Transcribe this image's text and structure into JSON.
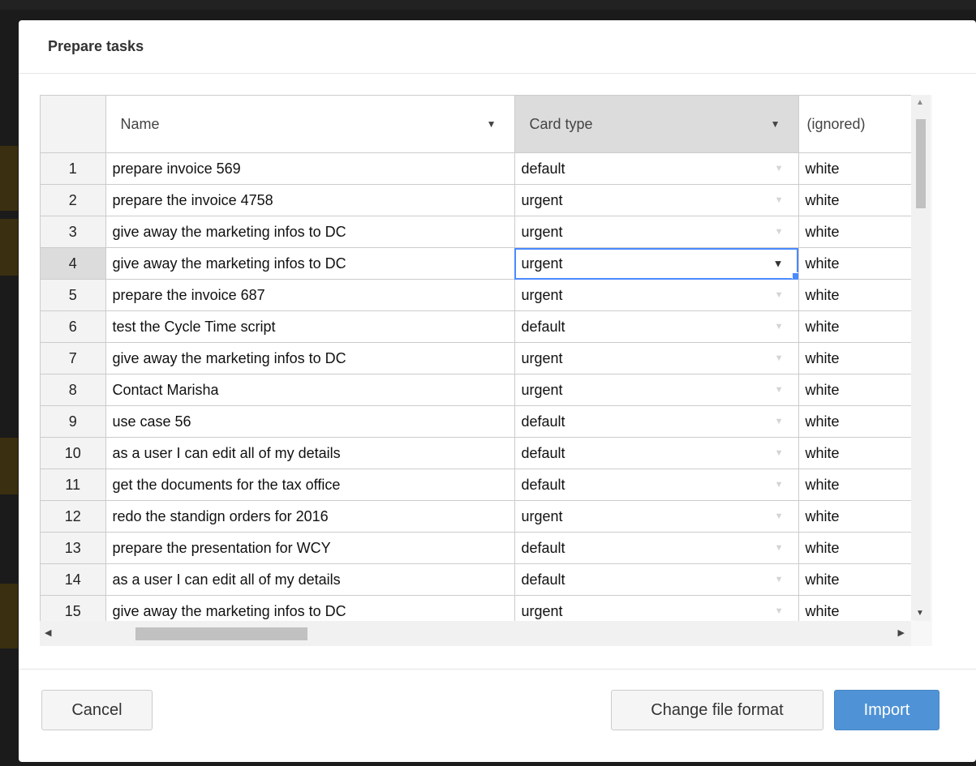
{
  "dialog": {
    "title": "Prepare tasks"
  },
  "grid": {
    "columns": [
      "Name",
      "Card type",
      "(ignored)"
    ],
    "rows": [
      {
        "num": "1",
        "name": "prepare invoice 569",
        "card_type": "default",
        "ignored": "white"
      },
      {
        "num": "2",
        "name": "prepare the invoice 4758",
        "card_type": "urgent",
        "ignored": "white"
      },
      {
        "num": "3",
        "name": "give away the marketing infos to DC",
        "card_type": "urgent",
        "ignored": "white"
      },
      {
        "num": "4",
        "name": "give away the marketing infos to DC",
        "card_type": "urgent",
        "ignored": "white"
      },
      {
        "num": "5",
        "name": "prepare the invoice 687",
        "card_type": "urgent",
        "ignored": "white"
      },
      {
        "num": "6",
        "name": "test the Cycle Time script",
        "card_type": "default",
        "ignored": "white"
      },
      {
        "num": "7",
        "name": "give away the marketing infos to DC",
        "card_type": "urgent",
        "ignored": "white"
      },
      {
        "num": "8",
        "name": "Contact Marisha",
        "card_type": "urgent",
        "ignored": "white"
      },
      {
        "num": "9",
        "name": "use case 56",
        "card_type": "default",
        "ignored": "white"
      },
      {
        "num": "10",
        "name": "as a user I can edit all of my details",
        "card_type": "default",
        "ignored": "white"
      },
      {
        "num": "11",
        "name": "get the documents for the tax office",
        "card_type": "default",
        "ignored": "white"
      },
      {
        "num": "12",
        "name": "redo the standign orders for 2016",
        "card_type": "urgent",
        "ignored": "white"
      },
      {
        "num": "13",
        "name": "prepare the presentation for WCY",
        "card_type": "default",
        "ignored": "white"
      },
      {
        "num": "14",
        "name": "as a user I can edit all of my details",
        "card_type": "default",
        "ignored": "white"
      },
      {
        "num": "15",
        "name": "give away the marketing infos to DC",
        "card_type": "urgent",
        "ignored": "white"
      }
    ],
    "selected_row": 4,
    "selected_column": "Card type"
  },
  "footer": {
    "cancel_label": "Cancel",
    "change_format_label": "Change file format",
    "import_label": "Import"
  },
  "colors": {
    "primary": "#4f93d6",
    "selection": "#4b89ff"
  },
  "icons": {
    "dropdown": "▼",
    "scroll_up": "▲",
    "scroll_down": "▼",
    "scroll_left": "◀",
    "scroll_right": "▶"
  }
}
